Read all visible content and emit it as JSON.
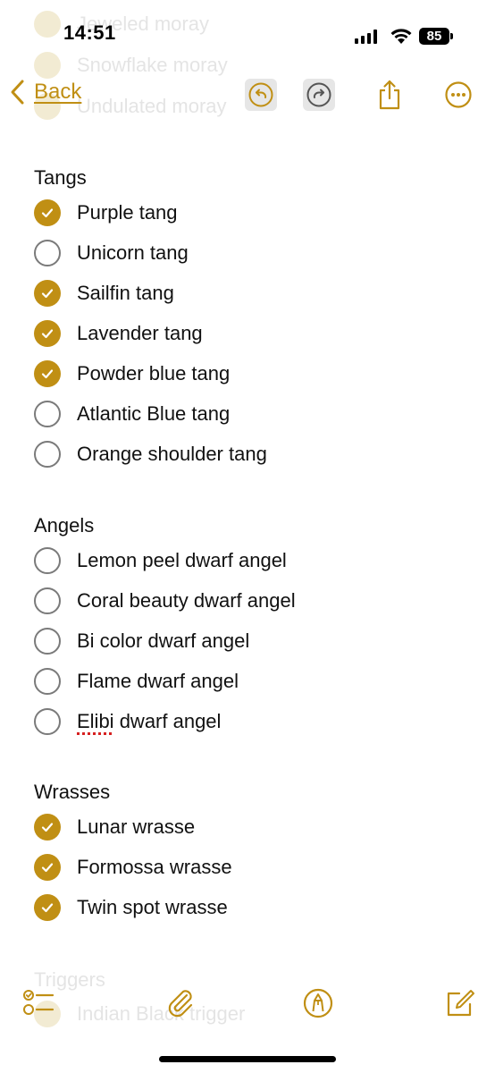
{
  "status_bar": {
    "time": "14:51",
    "battery": "85"
  },
  "ghost_top": [
    "Jeweled moray",
    "Snowflake moray",
    "Undulated moray"
  ],
  "ghost_bottom": {
    "section": "Triggers",
    "item": "Indian Black trigger"
  },
  "nav": {
    "back_label": "Back"
  },
  "sections": [
    {
      "title": "Tangs",
      "items": [
        {
          "label": "Purple tang",
          "checked": true
        },
        {
          "label": "Unicorn tang",
          "checked": false
        },
        {
          "label": "Sailfin tang",
          "checked": true
        },
        {
          "label": "Lavender tang",
          "checked": true
        },
        {
          "label": "Powder blue tang",
          "checked": true
        },
        {
          "label": "Atlantic Blue tang",
          "checked": false
        },
        {
          "label": "Orange shoulder tang",
          "checked": false
        }
      ]
    },
    {
      "title": "Angels",
      "items": [
        {
          "label": "Lemon peel dwarf angel",
          "checked": false
        },
        {
          "label": "Coral beauty dwarf angel",
          "checked": false
        },
        {
          "label": "Bi color dwarf angel",
          "checked": false
        },
        {
          "label": "Flame dwarf angel",
          "checked": false
        },
        {
          "label": "Elibi dwarf angel",
          "checked": false,
          "misspelled": "Elibi",
          "rest": " dwarf angel"
        }
      ]
    },
    {
      "title": "Wrasses",
      "items": [
        {
          "label": "Lunar wrasse",
          "checked": true
        },
        {
          "label": "Formossa wrasse",
          "checked": true
        },
        {
          "label": "Twin spot wrasse",
          "checked": true
        }
      ]
    }
  ],
  "colors": {
    "accent": "#c08f14",
    "unchecked_ring": "#7a7a7a",
    "text": "#111111"
  },
  "icons": {
    "nav": [
      "chevron-left-icon",
      "undo-icon",
      "redo-icon",
      "share-icon",
      "more-icon"
    ],
    "toolbar": [
      "checklist-icon",
      "paperclip-icon",
      "markup-pen-icon",
      "compose-icon"
    ]
  }
}
